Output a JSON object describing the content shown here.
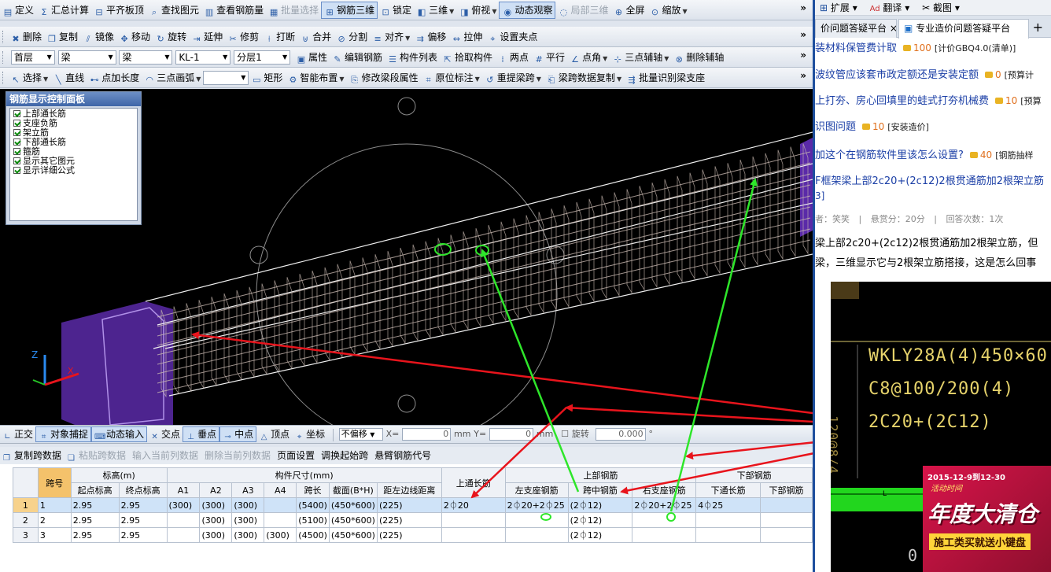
{
  "menu": {
    "items": [
      {
        "icon": "define-icon",
        "label": "定义"
      },
      {
        "icon": "sum-icon",
        "label": "汇总计算"
      },
      {
        "icon": "align-slab-icon",
        "label": "平齐板顶"
      },
      {
        "icon": "find-element-icon",
        "label": "查找图元"
      },
      {
        "icon": "view-rebar-icon",
        "label": "查看钢筋量"
      },
      {
        "icon": "batch-select-icon",
        "label": "批量选择",
        "disabled": true
      },
      {
        "icon": "rebar-3d-icon",
        "label": "钢筋三维",
        "active": true
      },
      {
        "icon": "lock-icon",
        "label": "锁定"
      },
      {
        "icon": "3d-icon",
        "label": "三维",
        "dropdown": true
      },
      {
        "icon": "top-view-icon",
        "label": "俯视",
        "dropdown": true
      },
      {
        "icon": "dynamic-view-icon",
        "label": "动态观察",
        "active": true
      },
      {
        "icon": "local-3d-icon",
        "label": "局部三维",
        "disabled": true
      },
      {
        "icon": "fullscreen-icon",
        "label": "全屏"
      },
      {
        "icon": "zoom-icon",
        "label": "缩放",
        "dropdown": true
      }
    ]
  },
  "edit_toolbar": {
    "items": [
      {
        "icon": "delete-icon",
        "label": "删除"
      },
      {
        "icon": "copy-icon",
        "label": "复制"
      },
      {
        "icon": "mirror-icon",
        "label": "镜像"
      },
      {
        "icon": "move-icon",
        "label": "移动"
      },
      {
        "icon": "rotate-icon",
        "label": "旋转"
      },
      {
        "icon": "extend-icon",
        "label": "延伸"
      },
      {
        "icon": "trim-icon",
        "label": "修剪"
      },
      {
        "icon": "break-icon",
        "label": "打断"
      },
      {
        "icon": "merge-icon",
        "label": "合并"
      },
      {
        "icon": "split-icon",
        "label": "分割"
      },
      {
        "icon": "align-icon",
        "label": "对齐",
        "dropdown": true
      },
      {
        "icon": "offset-icon",
        "label": "偏移"
      },
      {
        "icon": "stretch-icon",
        "label": "拉伸"
      },
      {
        "icon": "pinch-point-icon",
        "label": "设置夹点"
      }
    ]
  },
  "layer_toolbar": {
    "floor": "首层",
    "type": "梁",
    "subtype": "梁",
    "component": "KL-1",
    "layer": "分层1",
    "items": [
      {
        "icon": "property-icon",
        "label": "属性"
      },
      {
        "icon": "edit-rebar-icon",
        "label": "编辑钢筋"
      },
      {
        "icon": "component-list-icon",
        "label": "构件列表"
      },
      {
        "icon": "pick-component-icon",
        "label": "拾取构件"
      },
      {
        "icon": "two-point-icon",
        "label": "两点"
      },
      {
        "icon": "parallel-icon",
        "label": "平行"
      },
      {
        "icon": "point-angle-icon",
        "label": "点角",
        "dropdown": true
      },
      {
        "icon": "three-point-axis-icon",
        "label": "三点辅轴",
        "dropdown": true
      },
      {
        "icon": "delete-axis-icon",
        "label": "删除辅轴"
      }
    ]
  },
  "draw_toolbar": {
    "items": [
      {
        "icon": "select-icon",
        "label": "选择",
        "dropdown": true
      },
      {
        "icon": "line-icon",
        "label": "直线"
      },
      {
        "icon": "point-length-icon",
        "label": "点加长度"
      },
      {
        "icon": "arc-icon",
        "label": "三点画弧",
        "dropdown": true
      },
      {
        "icon": "blank-select",
        "label": "",
        "select": true
      },
      {
        "icon": "rectangle-icon",
        "label": "矩形"
      },
      {
        "icon": "smart-layout-icon",
        "label": "智能布置",
        "dropdown": true
      },
      {
        "icon": "modify-segment-icon",
        "label": "修改梁段属性"
      },
      {
        "icon": "in-situ-mark-icon",
        "label": "原位标注",
        "dropdown": true
      },
      {
        "icon": "re-span-icon",
        "label": "重提梁跨",
        "dropdown": true
      },
      {
        "icon": "span-copy-icon",
        "label": "梁跨数据复制",
        "dropdown": true
      },
      {
        "icon": "batch-support-icon",
        "label": "批量识别梁支座"
      }
    ]
  },
  "control_panel": {
    "title": "钢筋显示控制面板",
    "options": [
      "上部通长筋",
      "支座负筋",
      "架立筋",
      "下部通长筋",
      "箍筋",
      "显示其它图元",
      "显示详细公式"
    ]
  },
  "axes": {
    "z": "Z",
    "x": "X"
  },
  "snap_toolbar": {
    "items": [
      {
        "icon": "ortho-icon",
        "label": "正交"
      },
      {
        "icon": "object-snap-icon",
        "label": "对象捕捉",
        "active": true
      },
      {
        "icon": "dynamic-input-icon",
        "label": "动态输入",
        "active": true
      },
      {
        "icon": "intersection-icon",
        "label": "交点"
      },
      {
        "icon": "perpendicular-icon",
        "label": "垂点",
        "active": true
      },
      {
        "icon": "midpoint-icon",
        "label": "中点",
        "active": true
      },
      {
        "icon": "vertex-icon",
        "label": "顶点"
      },
      {
        "icon": "coordinate-icon",
        "label": "坐标"
      }
    ],
    "offset_mode": "不偏移",
    "x_label": "X=",
    "x_value": "0",
    "y_label": "Y=",
    "y_value": "0",
    "unit": "mm",
    "rotate_label": "旋转",
    "rotate_value": "0.000",
    "degree": "°"
  },
  "grid_toolbar": {
    "items": [
      {
        "label": "复制跨数据",
        "icon": "copy-span-icon"
      },
      {
        "label": "粘贴跨数据",
        "icon": "paste-span-icon",
        "disabled": true
      },
      {
        "label": "输入当前列数据",
        "disabled": true
      },
      {
        "label": "删除当前列数据",
        "disabled": true
      },
      {
        "label": "页面设置"
      },
      {
        "label": "调换起始跨"
      },
      {
        "label": "悬臂钢筋代号"
      }
    ]
  },
  "grid": {
    "group_headers": {
      "span_no": "跨号",
      "elevation": "标高(m)",
      "size": "构件尺寸(mm)",
      "top_through": "上通长筋",
      "top_rebar": "上部钢筋",
      "bottom_rebar": "下部钢筋"
    },
    "sub_headers": {
      "start_elev": "起点标高",
      "end_elev": "终点标高",
      "a1": "A1",
      "a2": "A2",
      "a3": "A3",
      "a4": "A4",
      "span_len": "跨长",
      "section": "截面(B*H)",
      "edge_dist": "距左边线距离",
      "left_support": "左支座钢筋",
      "mid_span": "跨中钢筋",
      "right_support": "右支座钢筋",
      "bottom_through": "下通长筋",
      "bottom_other": "下部钢筋"
    },
    "rows": [
      {
        "n": "1",
        "span": "1",
        "start": "2.95",
        "end": "2.95",
        "a1": "(300)",
        "a2": "(300)",
        "a3": "(300)",
        "a4": "",
        "len": "(5400)",
        "sec": "(450*600)",
        "edge": "(225)",
        "top": "2⏀20",
        "left": "2⏀20+2⏀25",
        "mid": "(2⏀12)",
        "right": "2⏀20+2⏀25",
        "bot": "4⏀25",
        "bot2": ""
      },
      {
        "n": "2",
        "span": "2",
        "start": "2.95",
        "end": "2.95",
        "a1": "",
        "a2": "(300)",
        "a3": "(300)",
        "a4": "",
        "len": "(5100)",
        "sec": "(450*600)",
        "edge": "(225)",
        "top": "",
        "left": "",
        "mid": "(2⏀12)",
        "right": "",
        "bot": "",
        "bot2": ""
      },
      {
        "n": "3",
        "span": "3",
        "start": "2.95",
        "end": "2.95",
        "a1": "",
        "a2": "(300)",
        "a3": "(300)",
        "a4": "(300)",
        "len": "(4500)",
        "sec": "(450*600)",
        "edge": "(225)",
        "top": "",
        "left": "",
        "mid": "(2⏀12)",
        "right": "",
        "bot": "",
        "bot2": ""
      }
    ]
  },
  "browser": {
    "top_items": [
      "扩展",
      "翻译",
      "截图"
    ],
    "tab_left": "价问题答疑平台",
    "tab_active": "专业造价问题答疑平台",
    "plus": "+"
  },
  "questions": [
    {
      "title": "装材料保管费计取",
      "points": "100",
      "tag": "[计价GBQ4.0(清单)]"
    },
    {
      "title": "波纹管应该套市政定额还是安装定额",
      "points": "0",
      "tag": "[预算计"
    },
    {
      "title": "上打夯、房心回填里的蛙式打夯机械费",
      "points": "10",
      "tag": "[预算"
    },
    {
      "title": "识图问题",
      "points": "10",
      "tag": "[安装造价]"
    },
    {
      "title": "加这个在钢筋软件里该怎么设置?",
      "points": "40",
      "tag": "[钢筋抽样"
    }
  ],
  "current_question": {
    "title": "F框架梁上部2c20+(2c12)2根贯通筋加2根架立筋",
    "title_cont": "3]",
    "asker": "者：笑笑",
    "bounty": "悬赏分：20分",
    "answers": "回答次数：1次",
    "body_line1": "梁上部2c20+(2c12)2根贯通筋加2根架立筋，但",
    "body_line2": "梁，三维显示它与2根架立筋搭接，这是怎么回事"
  },
  "cad": {
    "line1": "WKLY28A(4)450×60",
    "line2": "C8@100/200(4)",
    "line3": "2C20+(2C12)",
    "side_text": "120@8/4"
  },
  "ad": {
    "date": "2015-12-9到12-30",
    "sub": "活动时间",
    "big": "年度大清仓",
    "slogan": "施工类买就送小键盘"
  },
  "colors": {
    "arrow_red": "#e8141c",
    "arrow_green": "#2ee62a",
    "beam_purple": "#5a2aa8",
    "rebar": "#c8b8b0",
    "selected_row": "#cfe3f8",
    "accent_blue": "#1e4f9e"
  }
}
